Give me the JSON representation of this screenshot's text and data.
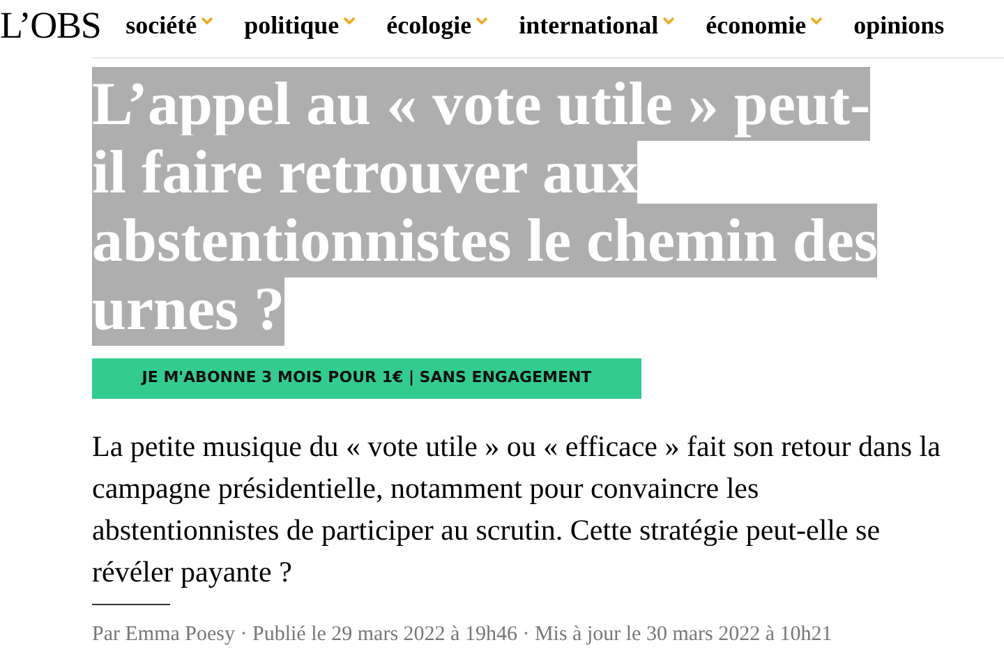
{
  "header": {
    "logo": "L’OBS",
    "nav": [
      {
        "label": "société",
        "has_menu": true
      },
      {
        "label": "politique",
        "has_menu": true
      },
      {
        "label": "écologie",
        "has_menu": true
      },
      {
        "label": "international",
        "has_menu": true
      },
      {
        "label": "économie",
        "has_menu": true
      },
      {
        "label": "opinions",
        "has_menu": false
      }
    ]
  },
  "article": {
    "title": "L’appel au « vote utile » peut-il faire retrouver aux abstentionnistes le chemin des urnes ?",
    "title_highlighted": true,
    "subscribe_button": "JE M'ABONNE 3 MOIS POUR 1€ | SANS ENGAGEMENT",
    "lede": "La petite musique du « vote utile » ou « efficace » fait son retour dans la campagne présidentielle, notamment pour convaincre les abstentionnistes de participer au scrutin. Cette stratégie peut-elle se révéler payante ?",
    "byline": "Par Emma Poesy · Publié le 29 mars 2022 à 19h46 · Mis à jour le 30 mars 2022 à 10h21"
  }
}
